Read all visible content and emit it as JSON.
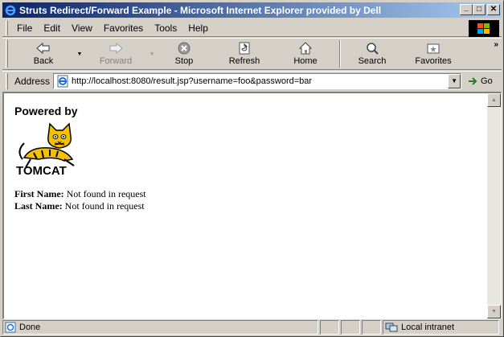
{
  "window": {
    "title": "Struts Redirect/Forward Example - Microsoft Internet Explorer provided by Dell",
    "minimize": "_",
    "maximize": "□",
    "close": "✕"
  },
  "menu": {
    "items": [
      {
        "label": "File"
      },
      {
        "label": "Edit"
      },
      {
        "label": "View"
      },
      {
        "label": "Favorites"
      },
      {
        "label": "Tools"
      },
      {
        "label": "Help"
      }
    ]
  },
  "toolbar": {
    "back": "Back",
    "forward": "Forward",
    "stop": "Stop",
    "refresh": "Refresh",
    "home": "Home",
    "search": "Search",
    "favorites": "Favorites",
    "more": "»"
  },
  "address": {
    "label": "Address",
    "url": "http://localhost:8080/result.jsp?username=foo&password=bar",
    "go": "Go"
  },
  "content": {
    "powered_by": "Powered by",
    "logo_text": "TOMCAT",
    "first_name_label": "First Name:",
    "first_name_value": "Not found in request",
    "last_name_label": "Last Name:",
    "last_name_value": "Not found in request"
  },
  "status": {
    "text": "Done",
    "zone": "Local intranet"
  },
  "colors": {
    "title_start": "#0a246a",
    "title_end": "#a6caf0",
    "chrome": "#d4d0c8"
  }
}
